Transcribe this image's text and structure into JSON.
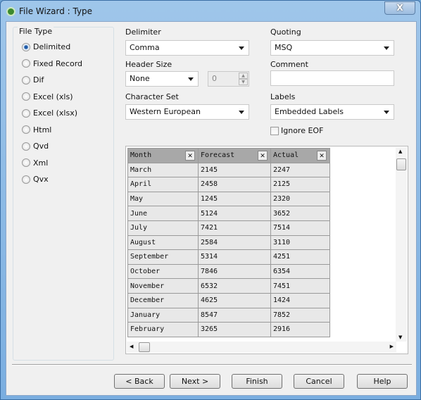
{
  "window": {
    "title": "File Wizard : Type",
    "close_label": "X"
  },
  "file_type": {
    "label": "File Type",
    "selected": "Delimited",
    "options": [
      "Delimited",
      "Fixed Record",
      "Dif",
      "Excel (xls)",
      "Excel (xlsx)",
      "Html",
      "Qvd",
      "Xml",
      "Qvx"
    ]
  },
  "delimiter": {
    "label": "Delimiter",
    "value": "Comma"
  },
  "quoting": {
    "label": "Quoting",
    "value": "MSQ"
  },
  "header_size": {
    "label": "Header Size",
    "value": "None",
    "spinner": "0"
  },
  "comment": {
    "label": "Comment",
    "value": ""
  },
  "character_set": {
    "label": "Character Set",
    "value": "Western European"
  },
  "labels": {
    "label": "Labels",
    "value": "Embedded Labels"
  },
  "ignore_eof": {
    "label": "Ignore EOF",
    "checked": false
  },
  "table": {
    "columns": [
      "Month",
      "Forecast",
      "Actual"
    ],
    "rows": [
      [
        "March",
        "2145",
        "2247"
      ],
      [
        "April",
        "2458",
        "2125"
      ],
      [
        "May",
        "1245",
        "2320"
      ],
      [
        "June",
        "5124",
        "3652"
      ],
      [
        "July",
        "7421",
        "7514"
      ],
      [
        "August",
        "2584",
        "3110"
      ],
      [
        "September",
        "5314",
        "4251"
      ],
      [
        "October",
        "7846",
        "6354"
      ],
      [
        "November",
        "6532",
        "7451"
      ],
      [
        "December",
        "4625",
        "1424"
      ],
      [
        "January",
        "8547",
        "7852"
      ],
      [
        "February",
        "3265",
        "2916"
      ]
    ]
  },
  "buttons": {
    "back": "< Back",
    "next": "Next >",
    "finish": "Finish",
    "cancel": "Cancel",
    "help": "Help"
  }
}
